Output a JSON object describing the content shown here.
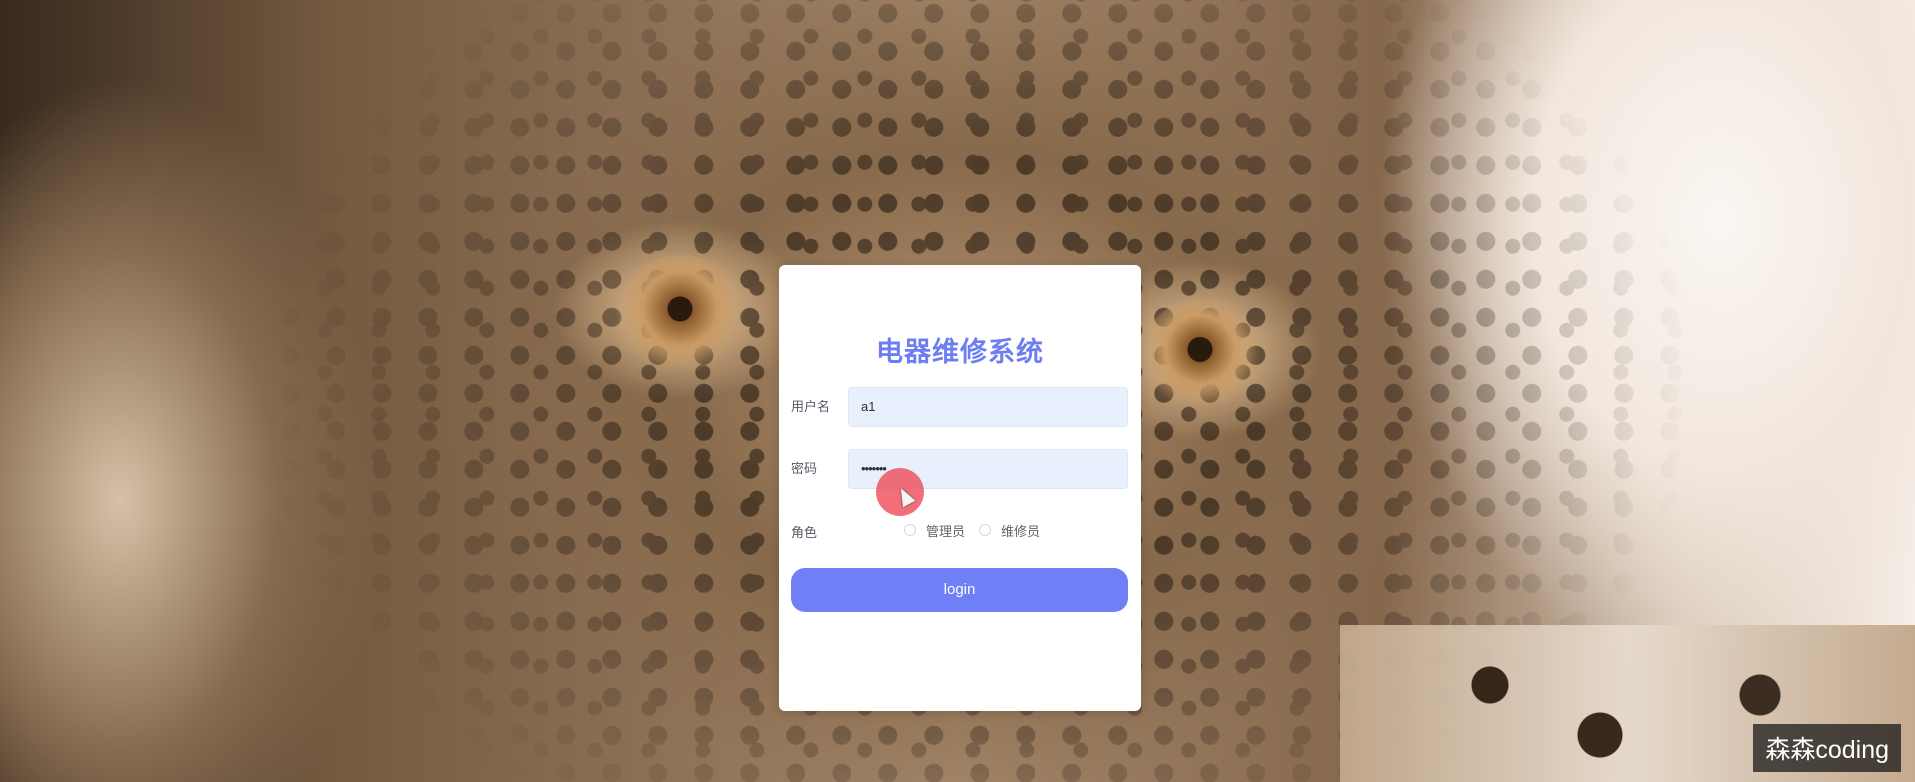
{
  "login_card": {
    "title": "电器维修系统",
    "username_label": "用户名",
    "username_value": "a1",
    "password_label": "密码",
    "password_value": "•••••••",
    "role_label": "角色",
    "role_options": [
      "管理员",
      "维修员"
    ],
    "login_button": "login"
  },
  "watermark": "森森coding",
  "colors": {
    "accent": "#6f7ff6",
    "title": "#6d7ff0",
    "input_bg": "#e8f0fe",
    "cursor": "#ee4654"
  }
}
